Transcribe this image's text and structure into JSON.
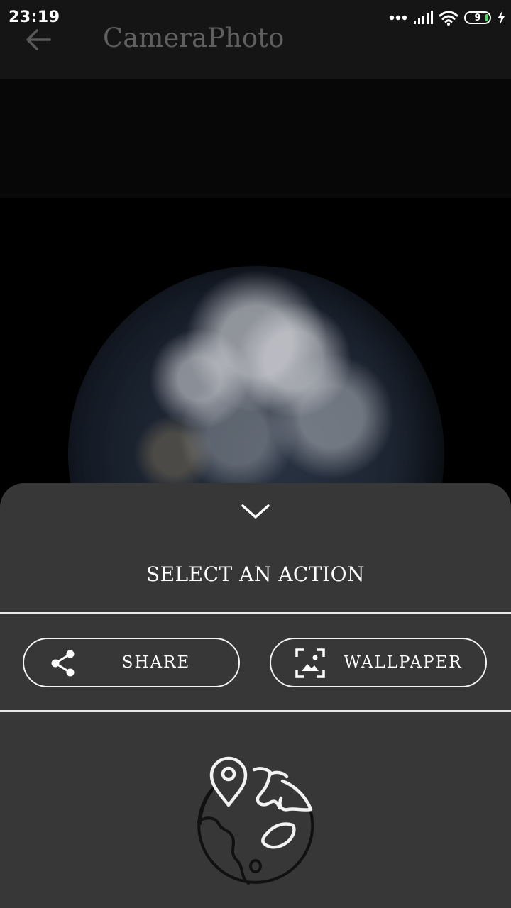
{
  "status_bar": {
    "time": "23:19",
    "battery_level": "9",
    "icons": [
      "more-dots-icon",
      "signal-icon",
      "wifi-icon",
      "battery-icon",
      "charging-icon"
    ]
  },
  "toolbar": {
    "title": "CameraPhoto",
    "back_icon": "arrow-left-icon"
  },
  "sheet": {
    "collapse_icon": "chevron-down-icon",
    "title": "SELECT AN ACTION",
    "actions": [
      {
        "label": "SHARE",
        "icon": "share-icon"
      },
      {
        "label": "WALLPAPER",
        "icon": "wallpaper-icon"
      }
    ],
    "illustration_icon": "globe-location-icon"
  },
  "colors": {
    "toolbar_bg": "#151515",
    "sheet_bg": "#373737",
    "title_dim": "#5f5f5f",
    "battery_accent": "#4cd964"
  }
}
